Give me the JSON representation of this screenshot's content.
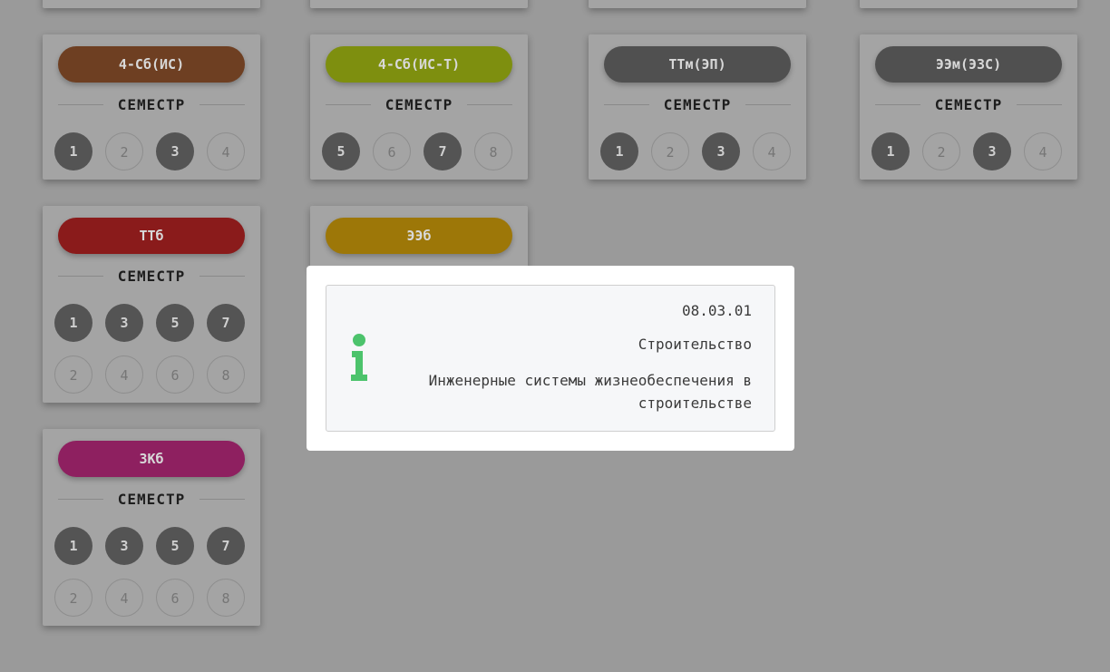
{
  "cards": [
    {
      "name": "4-Сб(ИС)",
      "color": "#6e3f22",
      "rows": [
        [
          {
            "n": "1",
            "on": true
          },
          {
            "n": "2",
            "on": false
          },
          {
            "n": "3",
            "on": true
          },
          {
            "n": "4",
            "on": false
          }
        ]
      ]
    },
    {
      "name": "4-Сб(ИС-Т)",
      "color": "#7e8f0f",
      "rows": [
        [
          {
            "n": "5",
            "on": true
          },
          {
            "n": "6",
            "on": false
          },
          {
            "n": "7",
            "on": true
          },
          {
            "n": "8",
            "on": false
          }
        ]
      ]
    },
    {
      "name": "ТТм(ЭП)",
      "color": "#505050",
      "rows": [
        [
          {
            "n": "1",
            "on": true
          },
          {
            "n": "2",
            "on": false
          },
          {
            "n": "3",
            "on": true
          },
          {
            "n": "4",
            "on": false
          }
        ]
      ]
    },
    {
      "name": "ЭЭм(ЭЗС)",
      "color": "#505050",
      "rows": [
        [
          {
            "n": "1",
            "on": true
          },
          {
            "n": "2",
            "on": false
          },
          {
            "n": "3",
            "on": true
          },
          {
            "n": "4",
            "on": false
          }
        ]
      ]
    },
    {
      "name": "ТТб",
      "color": "#8a1b1b",
      "rows": [
        [
          {
            "n": "1",
            "on": true
          },
          {
            "n": "3",
            "on": true
          },
          {
            "n": "5",
            "on": true
          },
          {
            "n": "7",
            "on": true
          }
        ],
        [
          {
            "n": "2",
            "on": false
          },
          {
            "n": "4",
            "on": false
          },
          {
            "n": "6",
            "on": false
          },
          {
            "n": "8",
            "on": false
          }
        ]
      ]
    },
    {
      "name": "ЭЭб",
      "color": "#9d7708",
      "rows": []
    },
    {
      "name": "ЗКб",
      "color": "#8e2060",
      "rows": [
        [
          {
            "n": "1",
            "on": true
          },
          {
            "n": "3",
            "on": true
          },
          {
            "n": "5",
            "on": true
          },
          {
            "n": "7",
            "on": true
          }
        ],
        [
          {
            "n": "2",
            "on": false
          },
          {
            "n": "4",
            "on": false
          },
          {
            "n": "6",
            "on": false
          },
          {
            "n": "8",
            "on": false
          }
        ]
      ]
    }
  ],
  "semester_label": "СЕМЕСТР",
  "info": {
    "icon": "info-icon",
    "icon_color": "#4cc36c",
    "code": "08.03.01",
    "direction": "Строительство",
    "profile": "Инженерные системы жизнеобеспечения в строительстве"
  }
}
